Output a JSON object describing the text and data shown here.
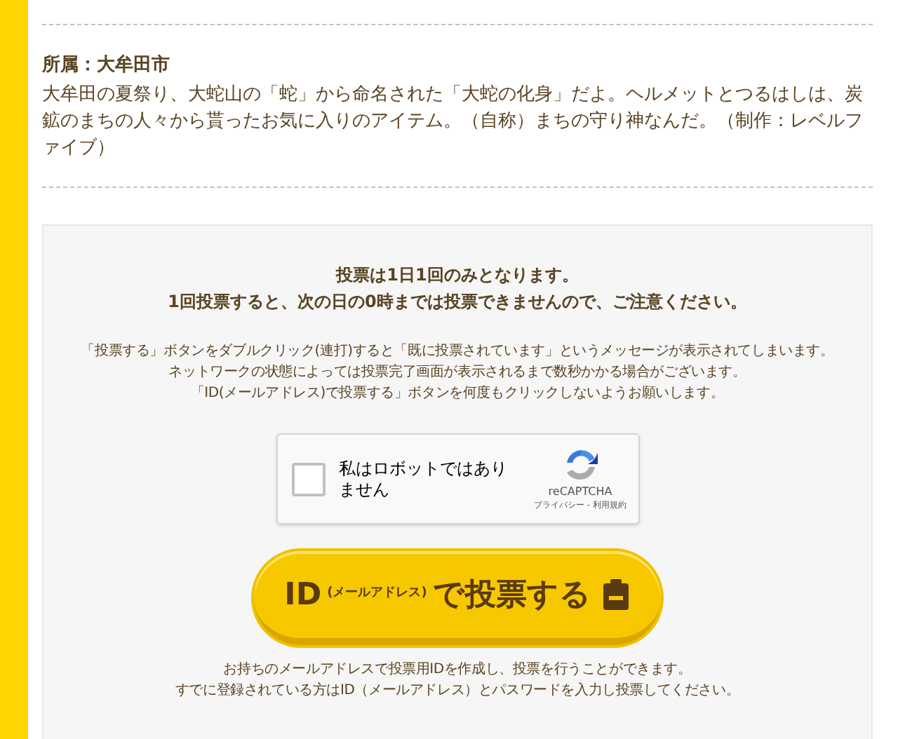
{
  "profile": {
    "affiliation": "所属：大牟田市",
    "description": "大牟田の夏祭り、大蛇山の「蛇」から命名された「大蛇の化身」だよ。ヘルメットとつるはしは、炭鉱のまちの人々から貰ったお気に入りのアイテム。（自称）まちの守り神なんだ。（制作：レベルファイブ）"
  },
  "vote": {
    "notice": [
      "投票は1日1回のみとなります。",
      "1回投票すると、次の日の0時までは投票できませんので、ご注意ください。"
    ],
    "cautions": [
      "「投票する」ボタンをダブルクリック(連打)すると「既に投票されています」というメッセージが表示されてしまいます。",
      "ネットワークの状態によっては投票完了画面が表示されるまで数秒かかる場合がございます。",
      "「ID(メールアドレス)で投票する」ボタンを何度もクリックしないようお願いします。"
    ],
    "captcha": {
      "label": "私はロボットではありません",
      "checked": false,
      "brand": "reCAPTCHA",
      "links": "プライバシー - 利用規約"
    },
    "button": {
      "id": "ID",
      "sub": "(メールアドレス)",
      "main": "で投票する"
    },
    "info": [
      "お持ちのメールアドレスで投票用IDを作成し、投票を行うことができます。",
      "すでに登録されている方はID（メールアドレス）とパスワードを入力し投票してください。"
    ]
  }
}
